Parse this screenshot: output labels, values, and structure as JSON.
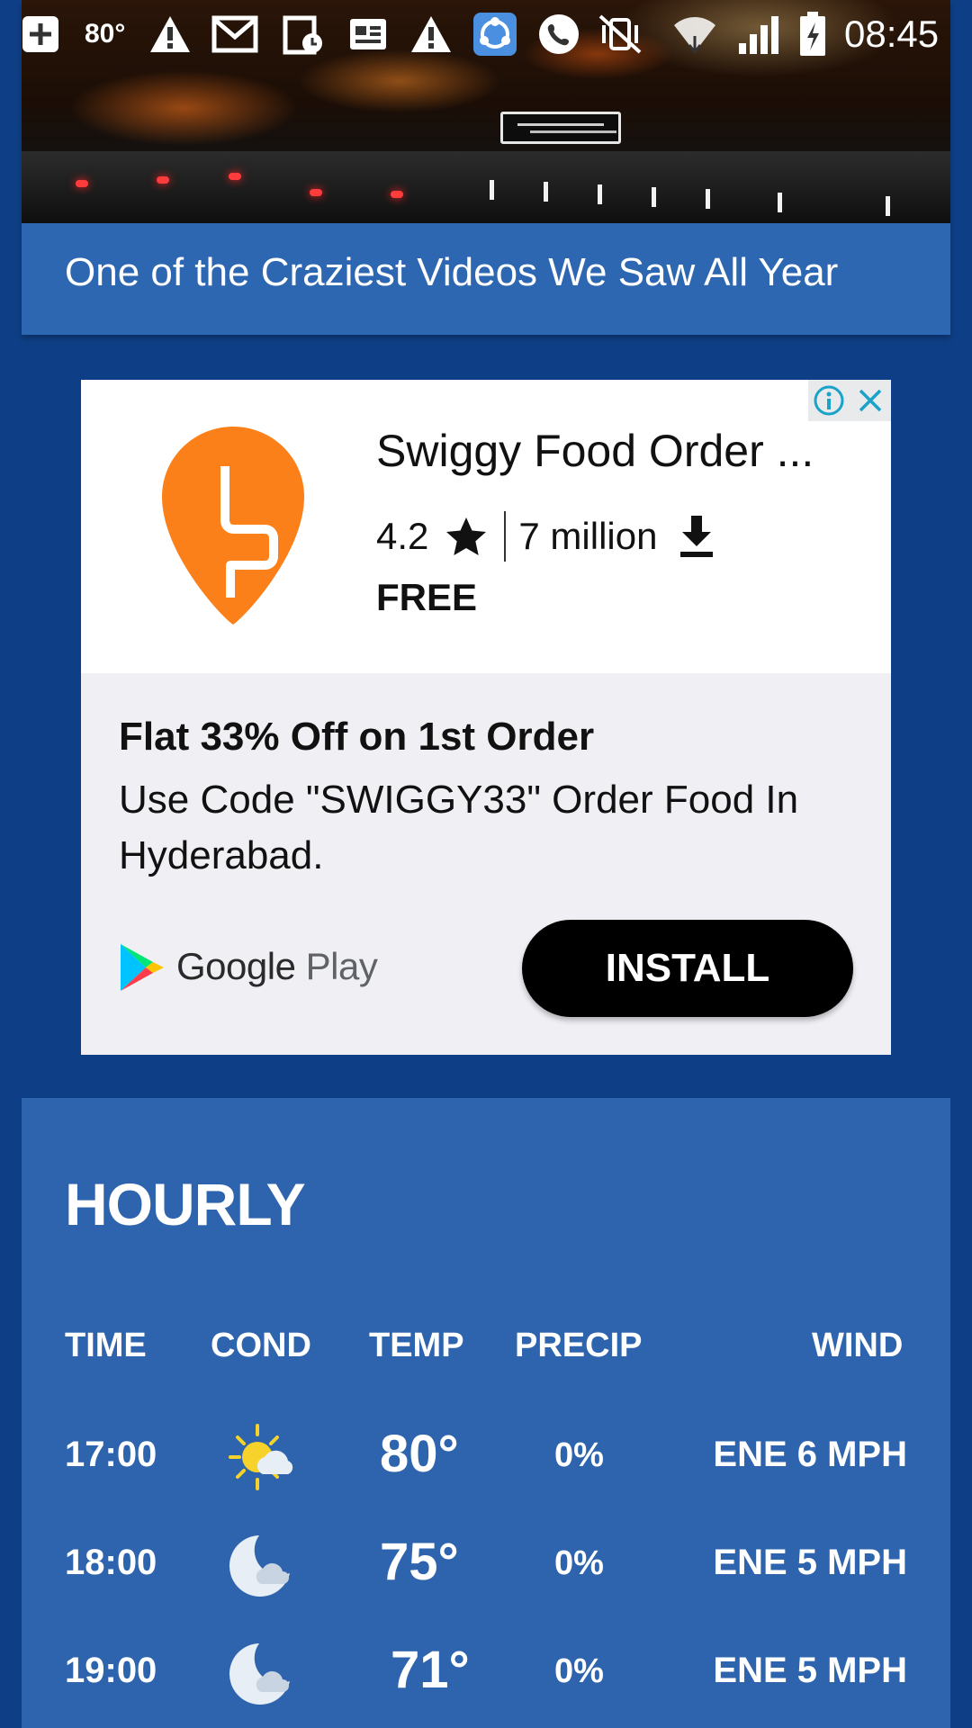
{
  "status_bar": {
    "temperature": "80°",
    "clock": "08:45",
    "icons": [
      "add-icon",
      "warning-icon",
      "gmail-icon",
      "calendar-clock-icon",
      "news-icon",
      "warning-icon",
      "sync-app-icon",
      "phone-icon",
      "vibrate-mute-icon",
      "wifi-icon",
      "signal-icon",
      "battery-charging-icon"
    ]
  },
  "video": {
    "title": "One of the Craziest Videos We Saw All Year"
  },
  "ad": {
    "app_name": "Swiggy Food Order ...",
    "rating": "4.2",
    "downloads": "7 million",
    "price": "FREE",
    "headline": "Flat 33% Off on 1st Order",
    "body": "Use Code \"SWIGGY33\" Order Food In Hyderabad.",
    "store_label_main": "Google",
    "store_label_sub": "Play",
    "install_label": "INSTALL",
    "brand_color": "#fc8019"
  },
  "hourly": {
    "title": "HOURLY",
    "columns": [
      "TIME",
      "COND",
      "TEMP",
      "PRECIP",
      "WIND"
    ],
    "rows": [
      {
        "time": "17:00",
        "cond": "sun-cloud-icon",
        "temp": "80°",
        "precip": "0%",
        "wind": "ENE 6 MPH"
      },
      {
        "time": "18:00",
        "cond": "moon-cloud-icon",
        "temp": "75°",
        "precip": "0%",
        "wind": "ENE 5 MPH"
      },
      {
        "time": "19:00",
        "cond": "moon-cloud-icon",
        "temp": "71°",
        "precip": "0%",
        "wind": "ENE 5 MPH"
      }
    ]
  },
  "colors": {
    "background": "#0e3f86",
    "card": "#2d64ad",
    "sun": "#f6d22a"
  }
}
